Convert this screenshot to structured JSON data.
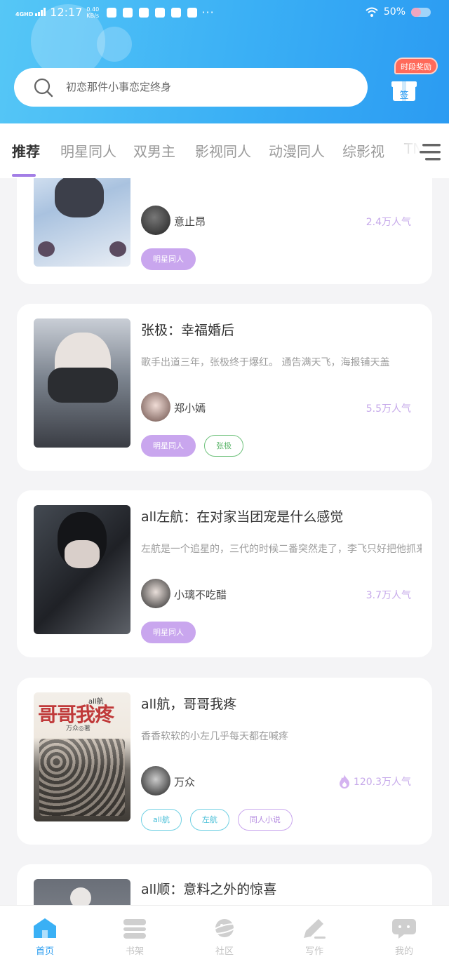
{
  "status_bar": {
    "network": "4G",
    "network_sub": "HD",
    "time": "12:17",
    "speed_top": "0.40",
    "speed_bottom": "KB/s",
    "battery": "50%"
  },
  "search": {
    "placeholder": "初恋那件小事恋定终身",
    "icon": "search-icon"
  },
  "reward": {
    "tag": "时段奖励",
    "box_label": "签"
  },
  "tabs": [
    {
      "label": "推荐",
      "active": true
    },
    {
      "label": "明星同人",
      "active": false
    },
    {
      "label": "双男主",
      "active": false
    },
    {
      "label": "影视同人",
      "active": false
    },
    {
      "label": "动漫同人",
      "active": false
    },
    {
      "label": "综影视",
      "active": false
    },
    {
      "label": "TN",
      "active": false
    }
  ],
  "cards": [
    {
      "title": "",
      "desc": "",
      "author": "意止昂",
      "popularity": "2.4万人气",
      "hot": false,
      "tags": [
        {
          "label": "明星同人",
          "style": "fill"
        }
      ]
    },
    {
      "title": "张极：幸福婚后",
      "desc": "歌手出道三年，张极终于爆红。   通告满天飞，海报铺天盖",
      "author": "郑小嫣",
      "popularity": "5.5万人气",
      "hot": false,
      "tags": [
        {
          "label": "明星同人",
          "style": "fill"
        },
        {
          "label": "张极",
          "style": "green"
        }
      ]
    },
    {
      "title": "all左航：在对家当团宠是什么感觉",
      "desc": "左航是一个追星的，三代的时候二番突然走了，李飞只好把他抓来了",
      "author": "小璃不吃醋",
      "popularity": "3.7万人气",
      "hot": false,
      "tags": [
        {
          "label": "明星同人",
          "style": "fill"
        }
      ]
    },
    {
      "title": "all航，哥哥我疼",
      "desc": "香香软软的小左几乎每天都在喊疼",
      "author": "万众",
      "popularity": "120.3万人气",
      "hot": true,
      "cover_text": "哥哥我疼",
      "cover_sub": "all航",
      "cover_author": "万众◎著",
      "tags": [
        {
          "label": "all航",
          "style": "cyan"
        },
        {
          "label": "左航",
          "style": "cyan"
        },
        {
          "label": "同人小说",
          "style": "purple"
        }
      ]
    },
    {
      "title": "all顺：意料之外的惊喜",
      "desc": "",
      "author": "",
      "popularity": "",
      "hot": false,
      "tags": []
    }
  ],
  "bottom_nav": [
    {
      "label": "首页",
      "icon": "home-icon",
      "active": true
    },
    {
      "label": "书架",
      "icon": "bookshelf-icon",
      "active": false
    },
    {
      "label": "社区",
      "icon": "community-planet-icon",
      "active": false
    },
    {
      "label": "写作",
      "icon": "write-pen-icon",
      "active": false
    },
    {
      "label": "我的",
      "icon": "profile-chat-icon",
      "active": false
    }
  ],
  "colors": {
    "header_start": "#56c7f6",
    "header_end": "#2b9bf2",
    "accent_purple": "#a37ee6",
    "tag_fill": "#c9a6ee",
    "nav_active": "#2f9ff0"
  }
}
